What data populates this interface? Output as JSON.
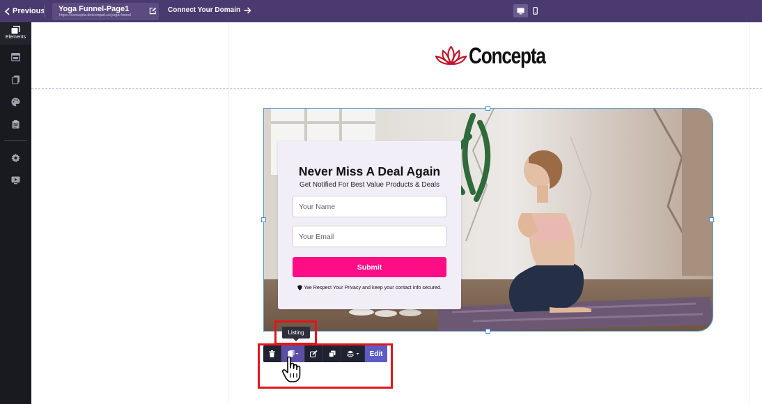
{
  "topbar": {
    "previous_label": "Previous",
    "page_title": "Yoga Funnel-Page1",
    "page_url": "https://concepta.dotcompal.co/yoga-funnel",
    "connect_label": "Connect Your Domain"
  },
  "sidebar": {
    "elements_label": "Elements"
  },
  "logo": {
    "text": "Concepta",
    "color": "#c0152a"
  },
  "form": {
    "title": "Never Miss A Deal Again",
    "subtitle": "Get Notified For Best Value Products & Deals",
    "name_placeholder": "Your Name",
    "email_placeholder": "Your Email",
    "submit_label": "Submit",
    "privacy_text": "We Respect Your Privacy and keep your contact info secured.",
    "submit_color": "#ff0d86"
  },
  "toolbar": {
    "tooltip": "Listing",
    "edit_label": "Edit"
  },
  "colors": {
    "topbar": "#4a3a70",
    "sidebar": "#181a20",
    "highlight": "#e3151b"
  }
}
